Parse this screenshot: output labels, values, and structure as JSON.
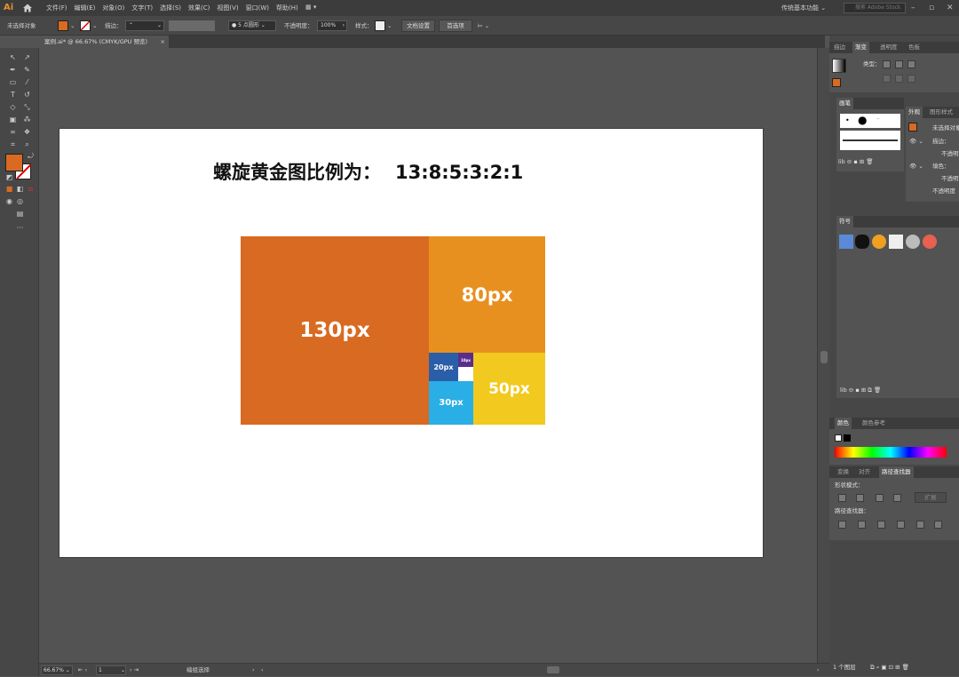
{
  "menubar": {
    "logo": "Ai",
    "items": [
      "文件(F)",
      "编辑(E)",
      "对象(O)",
      "文字(T)",
      "选择(S)",
      "效果(C)",
      "视图(V)",
      "窗口(W)",
      "帮助(H)"
    ],
    "workspace": "传统基本功能",
    "search_placeholder": "搜索 Adobe Stock"
  },
  "controlbar": {
    "selection_label": "未选择对象",
    "fill_color": "#d86a21",
    "stroke_label": "描边：",
    "stroke_value": "",
    "brush_label": "5 点圆形",
    "opacity_label": "不透明度：",
    "opacity_value": "100%",
    "style_label": "样式：",
    "doc_setup": "文档设置",
    "preferences": "首选项"
  },
  "document_tab": {
    "title": "案例.ai* @ 66.67% (CMYK/GPU 预览)",
    "close": "×"
  },
  "artboard": {
    "headline": "螺旋黄金图比例为：",
    "ratio": "13:8:5:3:2:1",
    "blocks": [
      {
        "label": "130px",
        "color": "#d86a21"
      },
      {
        "label": "80px",
        "color": "#e8901f"
      },
      {
        "label": "50px",
        "color": "#f2c91f"
      },
      {
        "label": "30px",
        "color": "#2aaee6"
      },
      {
        "label": "20px",
        "color": "#2a5ea8"
      },
      {
        "label": "10px",
        "color": "#5a2d8c"
      }
    ]
  },
  "statusbar": {
    "zoom": "66.67%",
    "page": "1",
    "tool": "编组选择"
  },
  "dock": {
    "top_tabs": [
      "描边",
      "渐变",
      "透明度",
      "色板"
    ],
    "gradient_type_label": "类型：",
    "brush_panel_title": "画笔",
    "appearance_tabs": [
      "外观",
      "图形样式"
    ],
    "appearance_rows": [
      "未选择对象",
      "描边：",
      "不透明",
      "填色：",
      "不透明",
      "不透明度"
    ],
    "symbols_title": "符号",
    "color_tabs": [
      "颜色",
      "颜色参考"
    ],
    "lower_tabs": [
      "变换",
      "对齐",
      "路径查找器"
    ],
    "shape_modes_label": "形状模式：",
    "expand_button": "扩展",
    "pathfinder_label": "路径查找器：",
    "layers_count": "1 个图层"
  }
}
